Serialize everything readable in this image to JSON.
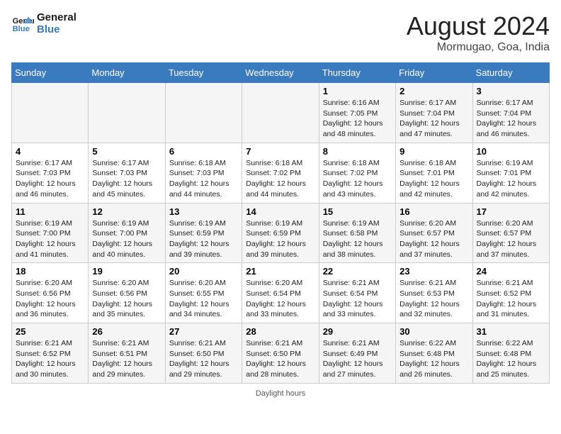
{
  "header": {
    "logo_line1": "General",
    "logo_line2": "Blue",
    "title": "August 2024",
    "subtitle": "Mormugao, Goa, India"
  },
  "days_of_week": [
    "Sunday",
    "Monday",
    "Tuesday",
    "Wednesday",
    "Thursday",
    "Friday",
    "Saturday"
  ],
  "weeks": [
    [
      {
        "day": "",
        "info": ""
      },
      {
        "day": "",
        "info": ""
      },
      {
        "day": "",
        "info": ""
      },
      {
        "day": "",
        "info": ""
      },
      {
        "day": "1",
        "info": "Sunrise: 6:16 AM\nSunset: 7:05 PM\nDaylight: 12 hours\nand 48 minutes."
      },
      {
        "day": "2",
        "info": "Sunrise: 6:17 AM\nSunset: 7:04 PM\nDaylight: 12 hours\nand 47 minutes."
      },
      {
        "day": "3",
        "info": "Sunrise: 6:17 AM\nSunset: 7:04 PM\nDaylight: 12 hours\nand 46 minutes."
      }
    ],
    [
      {
        "day": "4",
        "info": "Sunrise: 6:17 AM\nSunset: 7:03 PM\nDaylight: 12 hours\nand 46 minutes."
      },
      {
        "day": "5",
        "info": "Sunrise: 6:17 AM\nSunset: 7:03 PM\nDaylight: 12 hours\nand 45 minutes."
      },
      {
        "day": "6",
        "info": "Sunrise: 6:18 AM\nSunset: 7:03 PM\nDaylight: 12 hours\nand 44 minutes."
      },
      {
        "day": "7",
        "info": "Sunrise: 6:18 AM\nSunset: 7:02 PM\nDaylight: 12 hours\nand 44 minutes."
      },
      {
        "day": "8",
        "info": "Sunrise: 6:18 AM\nSunset: 7:02 PM\nDaylight: 12 hours\nand 43 minutes."
      },
      {
        "day": "9",
        "info": "Sunrise: 6:18 AM\nSunset: 7:01 PM\nDaylight: 12 hours\nand 42 minutes."
      },
      {
        "day": "10",
        "info": "Sunrise: 6:19 AM\nSunset: 7:01 PM\nDaylight: 12 hours\nand 42 minutes."
      }
    ],
    [
      {
        "day": "11",
        "info": "Sunrise: 6:19 AM\nSunset: 7:00 PM\nDaylight: 12 hours\nand 41 minutes."
      },
      {
        "day": "12",
        "info": "Sunrise: 6:19 AM\nSunset: 7:00 PM\nDaylight: 12 hours\nand 40 minutes."
      },
      {
        "day": "13",
        "info": "Sunrise: 6:19 AM\nSunset: 6:59 PM\nDaylight: 12 hours\nand 39 minutes."
      },
      {
        "day": "14",
        "info": "Sunrise: 6:19 AM\nSunset: 6:59 PM\nDaylight: 12 hours\nand 39 minutes."
      },
      {
        "day": "15",
        "info": "Sunrise: 6:19 AM\nSunset: 6:58 PM\nDaylight: 12 hours\nand 38 minutes."
      },
      {
        "day": "16",
        "info": "Sunrise: 6:20 AM\nSunset: 6:57 PM\nDaylight: 12 hours\nand 37 minutes."
      },
      {
        "day": "17",
        "info": "Sunrise: 6:20 AM\nSunset: 6:57 PM\nDaylight: 12 hours\nand 37 minutes."
      }
    ],
    [
      {
        "day": "18",
        "info": "Sunrise: 6:20 AM\nSunset: 6:56 PM\nDaylight: 12 hours\nand 36 minutes."
      },
      {
        "day": "19",
        "info": "Sunrise: 6:20 AM\nSunset: 6:56 PM\nDaylight: 12 hours\nand 35 minutes."
      },
      {
        "day": "20",
        "info": "Sunrise: 6:20 AM\nSunset: 6:55 PM\nDaylight: 12 hours\nand 34 minutes."
      },
      {
        "day": "21",
        "info": "Sunrise: 6:20 AM\nSunset: 6:54 PM\nDaylight: 12 hours\nand 33 minutes."
      },
      {
        "day": "22",
        "info": "Sunrise: 6:21 AM\nSunset: 6:54 PM\nDaylight: 12 hours\nand 33 minutes."
      },
      {
        "day": "23",
        "info": "Sunrise: 6:21 AM\nSunset: 6:53 PM\nDaylight: 12 hours\nand 32 minutes."
      },
      {
        "day": "24",
        "info": "Sunrise: 6:21 AM\nSunset: 6:52 PM\nDaylight: 12 hours\nand 31 minutes."
      }
    ],
    [
      {
        "day": "25",
        "info": "Sunrise: 6:21 AM\nSunset: 6:52 PM\nDaylight: 12 hours\nand 30 minutes."
      },
      {
        "day": "26",
        "info": "Sunrise: 6:21 AM\nSunset: 6:51 PM\nDaylight: 12 hours\nand 29 minutes."
      },
      {
        "day": "27",
        "info": "Sunrise: 6:21 AM\nSunset: 6:50 PM\nDaylight: 12 hours\nand 29 minutes."
      },
      {
        "day": "28",
        "info": "Sunrise: 6:21 AM\nSunset: 6:50 PM\nDaylight: 12 hours\nand 28 minutes."
      },
      {
        "day": "29",
        "info": "Sunrise: 6:21 AM\nSunset: 6:49 PM\nDaylight: 12 hours\nand 27 minutes."
      },
      {
        "day": "30",
        "info": "Sunrise: 6:22 AM\nSunset: 6:48 PM\nDaylight: 12 hours\nand 26 minutes."
      },
      {
        "day": "31",
        "info": "Sunrise: 6:22 AM\nSunset: 6:48 PM\nDaylight: 12 hours\nand 25 minutes."
      }
    ]
  ],
  "footer": {
    "daylight_label": "Daylight hours"
  }
}
